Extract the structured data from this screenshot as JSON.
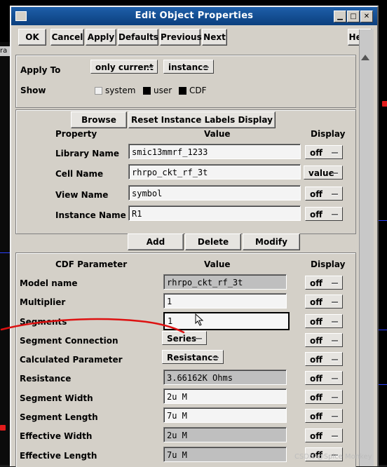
{
  "window": {
    "title": "Edit Object Properties"
  },
  "background": {
    "left_label": "ra"
  },
  "toolbar": {
    "ok": "OK",
    "cancel": "Cancel",
    "apply": "Apply",
    "defaults": "Defaults",
    "previous": "Previous",
    "next": "Next",
    "help": "Help"
  },
  "applyto": {
    "label": "Apply To",
    "scope": "only current",
    "type": "instance"
  },
  "show": {
    "label": "Show",
    "system": "system",
    "user": "user",
    "cdf": "CDF"
  },
  "attrs": {
    "browse": "Browse",
    "reset": "Reset Instance Labels Display",
    "headers": {
      "property": "Property",
      "value": "Value",
      "display": "Display"
    },
    "rows": [
      {
        "label": "Library Name",
        "value": "smic13mmrf_1233",
        "display": "off"
      },
      {
        "label": "Cell Name",
        "value": "rhrpo_ckt_rf_3t",
        "display": "value"
      },
      {
        "label": "View Name",
        "value": "symbol",
        "display": "off"
      },
      {
        "label": "Instance Name",
        "value": "R1",
        "display": "off"
      }
    ]
  },
  "userprops": {
    "add": "Add",
    "delete": "Delete",
    "modify": "Modify"
  },
  "cdf": {
    "headers": {
      "param": "CDF Parameter",
      "value": "Value",
      "display": "Display"
    },
    "rows": [
      {
        "label": "Model name",
        "value": "rhrpo_ckt_rf_3t",
        "display": "off"
      },
      {
        "label": "Multiplier",
        "value": "1",
        "display": "off"
      },
      {
        "label": "Segments",
        "value": "1",
        "display": "off"
      },
      {
        "label": "Segment Connection",
        "value": "Series",
        "display": "off"
      },
      {
        "label": "Calculated Parameter",
        "value": "Resistance",
        "display": "off"
      },
      {
        "label": "Resistance",
        "value": "3.66162K Ohms",
        "display": "off"
      },
      {
        "label": "Segment Width",
        "value": "2u M",
        "display": "off"
      },
      {
        "label": "Segment Length",
        "value": "7u M",
        "display": "off"
      },
      {
        "label": "Effective Width",
        "value": "2u M",
        "display": "off"
      },
      {
        "label": "Effective Length",
        "value": "7u M",
        "display": "off"
      }
    ]
  },
  "watermark": "CSDN @Spice Monkey"
}
